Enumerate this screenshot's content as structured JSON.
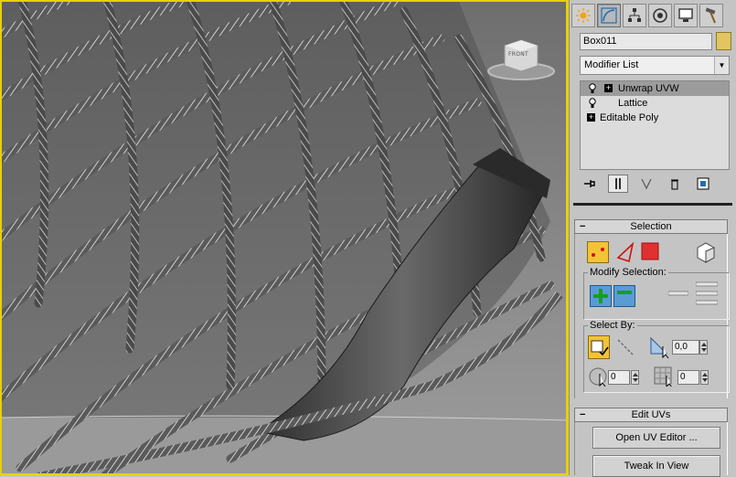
{
  "viewport": {
    "viewcube_label": "FRONT",
    "border_color": "#e6d200"
  },
  "command_panel": {
    "tabs": [
      {
        "name": "create-tab",
        "icon": "sun-create-icon"
      },
      {
        "name": "modify-tab",
        "icon": "curve-modify-icon",
        "active": true
      },
      {
        "name": "hierarchy-tab",
        "icon": "hierarchy-icon"
      },
      {
        "name": "motion-tab",
        "icon": "motion-icon"
      },
      {
        "name": "display-tab",
        "icon": "display-monitor-icon"
      },
      {
        "name": "utilities-tab",
        "icon": "hammer-icon"
      }
    ],
    "object_name": "Box011",
    "object_color": "#e2c55f",
    "modifier_list": "Modifier List",
    "stack": [
      {
        "label": "Unwrap UVW",
        "selected": true,
        "bulb": true,
        "expandable": true
      },
      {
        "label": "Lattice",
        "selected": false,
        "bulb": true,
        "expandable": false
      },
      {
        "label": "Editable Poly",
        "selected": false,
        "bulb": false,
        "expandable": true
      }
    ]
  },
  "selection_rollout": {
    "title": "Selection",
    "modify_selection_title": "Modify Selection:",
    "select_by_title": "Select By:",
    "angle_value": "0,0",
    "spinner_left": "0",
    "spinner_right": "0"
  },
  "edit_uvs_rollout": {
    "title": "Edit UVs",
    "open_uv_editor": "Open UV Editor ...",
    "tweak_in_view": "Tweak In View"
  }
}
